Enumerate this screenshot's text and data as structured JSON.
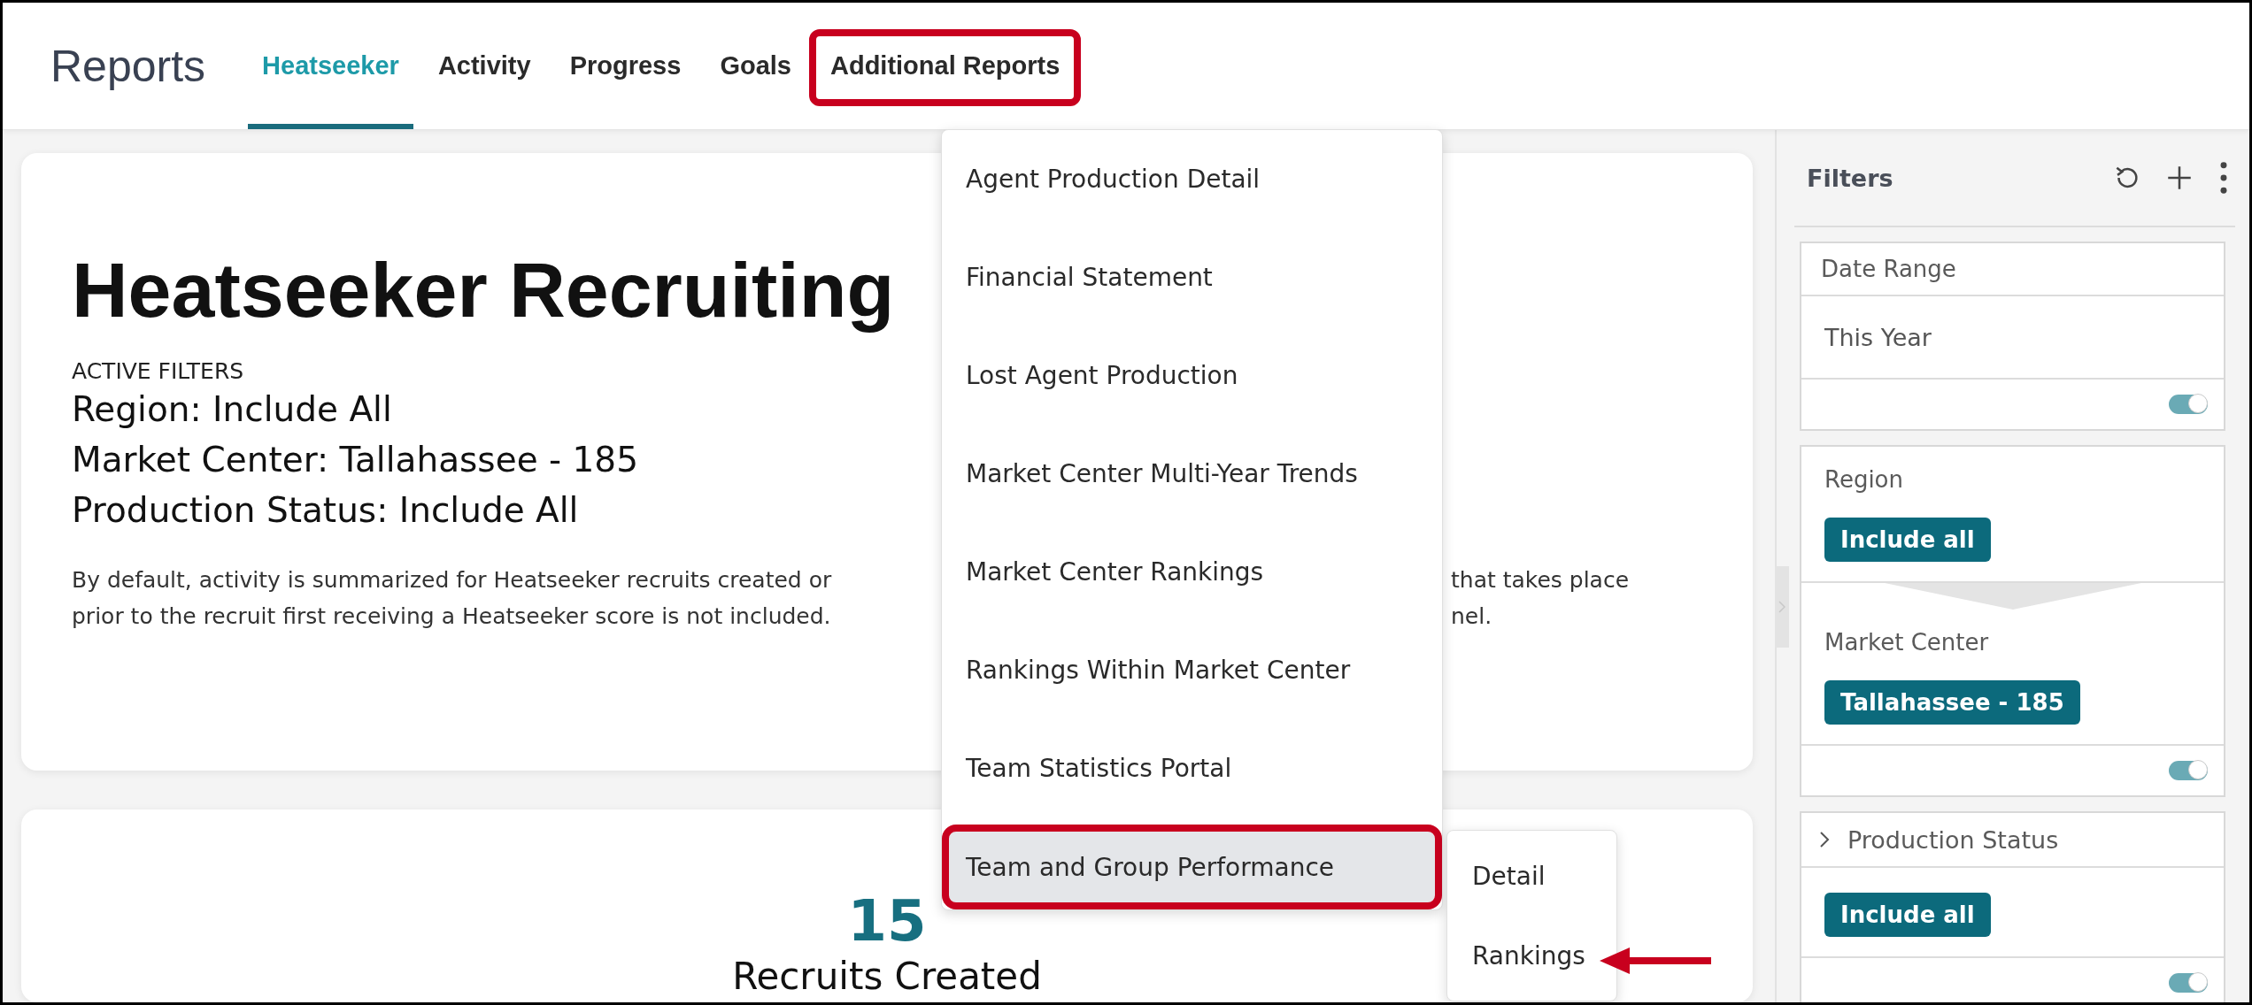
{
  "header": {
    "title": "Reports",
    "tabs": [
      {
        "label": "Heatseeker",
        "selected": true,
        "highlighted": false
      },
      {
        "label": "Activity",
        "selected": false,
        "highlighted": false
      },
      {
        "label": "Progress",
        "selected": false,
        "highlighted": false
      },
      {
        "label": "Goals",
        "selected": false,
        "highlighted": false
      },
      {
        "label": "Additional Reports",
        "selected": false,
        "highlighted": true
      }
    ]
  },
  "report_card": {
    "title": "Heatseeker Recruiting",
    "filters_label": "ACTIVE FILTERS",
    "active_filters": [
      "Region: Include All",
      "Market Center: Tallahassee - 185",
      "Production Status: Include All"
    ],
    "description_left": [
      "By default, activity is summarized for Heatseeker recruits created or",
      "prior to the recruit first receiving a Heatseeker score is not included."
    ],
    "description_right": [
      "that takes place",
      "nel."
    ]
  },
  "summary_card": {
    "value": "15",
    "label": "Recruits Created"
  },
  "dropdown": {
    "items": [
      {
        "label": "Agent Production Detail",
        "selected": false,
        "highlighted": false
      },
      {
        "label": "Financial Statement",
        "selected": false,
        "highlighted": false
      },
      {
        "label": "Lost Agent Production",
        "selected": false,
        "highlighted": false
      },
      {
        "label": "Market Center Multi-Year Trends",
        "selected": false,
        "highlighted": false
      },
      {
        "label": "Market Center Rankings",
        "selected": false,
        "highlighted": false
      },
      {
        "label": "Rankings Within Market Center",
        "selected": false,
        "highlighted": false
      },
      {
        "label": "Team Statistics Portal",
        "selected": false,
        "highlighted": false
      },
      {
        "label": "Team and Group Performance",
        "selected": true,
        "highlighted": true
      }
    ]
  },
  "submenu": {
    "items": [
      {
        "label": "Detail",
        "arrow": false
      },
      {
        "label": "Rankings",
        "arrow": true
      }
    ]
  },
  "filters_panel": {
    "title": "Filters",
    "cards": [
      {
        "sections": [
          {
            "kind": "header",
            "label": "Date Range"
          },
          {
            "kind": "value",
            "text": "This Year"
          },
          {
            "kind": "toggle",
            "on": true
          }
        ]
      },
      {
        "sections": [
          {
            "kind": "label",
            "label": "Region"
          },
          {
            "kind": "chip",
            "text": "Include all"
          },
          {
            "kind": "wedge"
          },
          {
            "kind": "label",
            "label": "Market Center"
          },
          {
            "kind": "chip",
            "text": "Tallahassee - 185"
          },
          {
            "kind": "toggle",
            "on": true
          }
        ]
      },
      {
        "sections": [
          {
            "kind": "expander",
            "label": "Production Status"
          },
          {
            "kind": "chip",
            "text": "Include all"
          },
          {
            "kind": "toggle",
            "on": true
          }
        ]
      }
    ]
  }
}
